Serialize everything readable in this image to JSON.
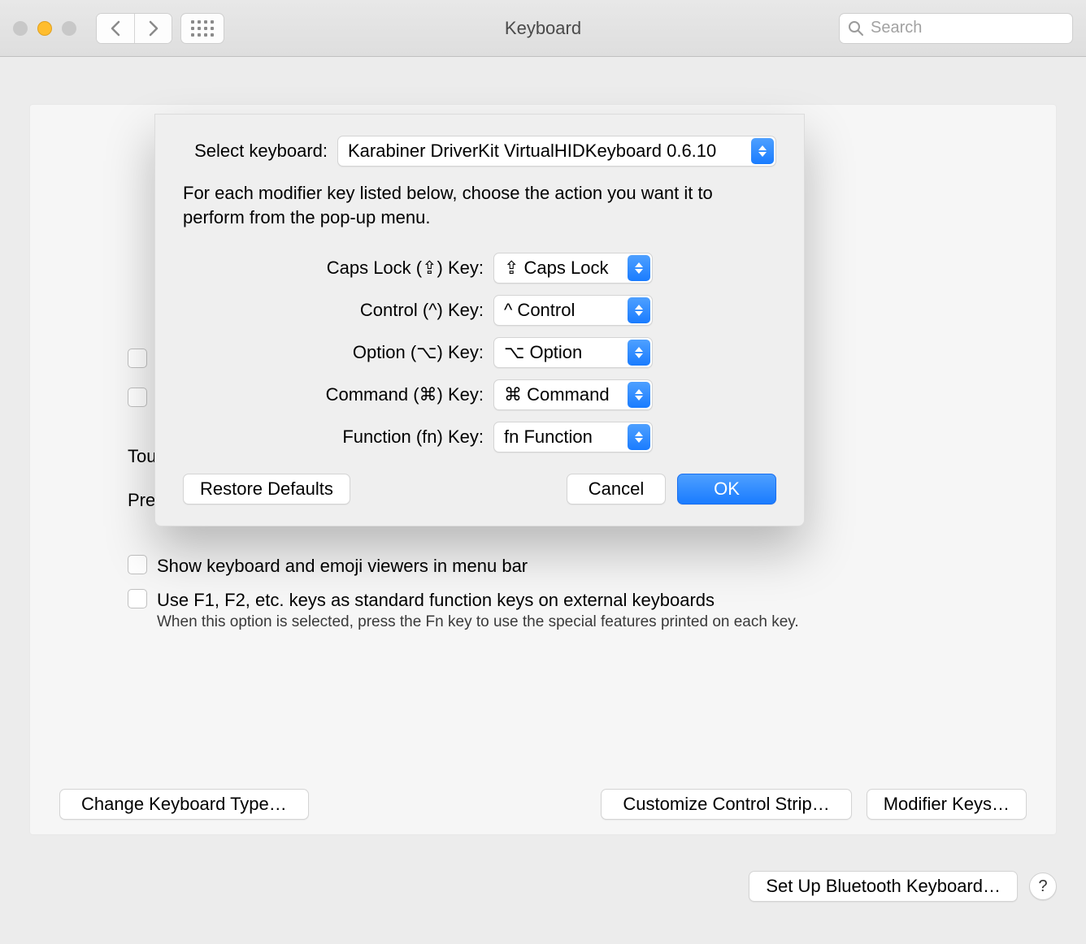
{
  "window": {
    "title": "Keyboard",
    "search_placeholder": "Search"
  },
  "sheet": {
    "select_label": "Select keyboard:",
    "keyboard_value": "Karabiner DriverKit VirtualHIDKeyboard 0.6.10",
    "description": "For each modifier key listed below, choose the action you want it to perform from the pop-up menu.",
    "rows": [
      {
        "label": "Caps Lock (⇪) Key:",
        "value": "⇪ Caps Lock"
      },
      {
        "label": "Control (^) Key:",
        "value": "^ Control"
      },
      {
        "label": "Option (⌥) Key:",
        "value": "⌥ Option"
      },
      {
        "label": "Command (⌘) Key:",
        "value": "⌘ Command"
      },
      {
        "label": "Function (fn) Key:",
        "value": "fn Function"
      }
    ],
    "restore": "Restore Defaults",
    "cancel": "Cancel",
    "ok": "OK"
  },
  "background": {
    "peek_tou": "Tou",
    "peek_pre": "Pre",
    "check_viewers": "Show keyboard and emoji viewers in menu bar",
    "check_fn": "Use F1, F2, etc. keys as standard function keys on external keyboards",
    "fn_hint": "When this option is selected, press the Fn key to use the special features printed on each key.",
    "btn_change_type": "Change Keyboard Type…",
    "btn_customize": "Customize Control Strip…",
    "btn_modifier": "Modifier Keys…",
    "btn_bluetooth": "Set Up Bluetooth Keyboard…"
  }
}
